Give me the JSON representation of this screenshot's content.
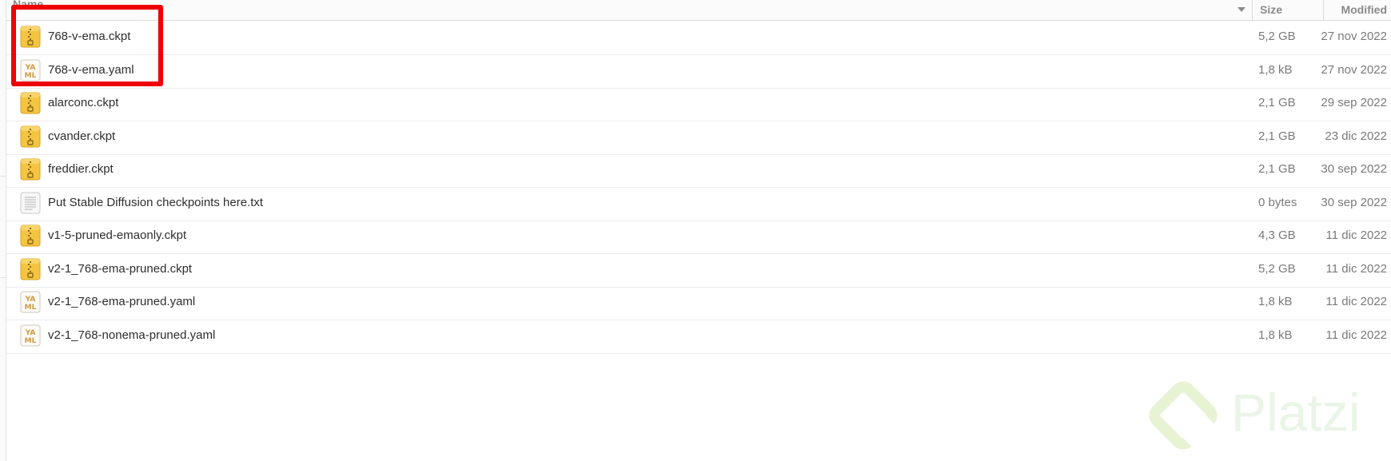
{
  "header": {
    "name_label": "Name",
    "size_label": "Size",
    "modified_label": "Modified"
  },
  "files": [
    {
      "name": "768-v-ema.ckpt",
      "size": "5,2 GB",
      "modified": "27 nov 2022",
      "icon": "archive-icon"
    },
    {
      "name": "768-v-ema.yaml",
      "size": "1,8 kB",
      "modified": "27 nov 2022",
      "icon": "yaml-icon"
    },
    {
      "name": "alarconc.ckpt",
      "size": "2,1 GB",
      "modified": "29 sep 2022",
      "icon": "archive-icon"
    },
    {
      "name": "cvander.ckpt",
      "size": "2,1 GB",
      "modified": "23 dic 2022",
      "icon": "archive-icon"
    },
    {
      "name": "freddier.ckpt",
      "size": "2,1 GB",
      "modified": "30 sep 2022",
      "icon": "archive-icon"
    },
    {
      "name": "Put Stable Diffusion checkpoints here.txt",
      "size": "0 bytes",
      "modified": "30 sep 2022",
      "icon": "text-file-icon"
    },
    {
      "name": "v1-5-pruned-emaonly.ckpt",
      "size": "4,3 GB",
      "modified": "11 dic 2022",
      "icon": "archive-icon"
    },
    {
      "name": "v2-1_768-ema-pruned.ckpt",
      "size": "5,2 GB",
      "modified": "11 dic 2022",
      "icon": "archive-icon"
    },
    {
      "name": "v2-1_768-ema-pruned.yaml",
      "size": "1,8 kB",
      "modified": "11 dic 2022",
      "icon": "yaml-icon"
    },
    {
      "name": "v2-1_768-nonema-pruned.yaml",
      "size": "1,8 kB",
      "modified": "11 dic 2022",
      "icon": "yaml-icon"
    }
  ],
  "highlight_color": "#ee0000",
  "watermark": {
    "text": "Platzi",
    "color": "#98ca3f"
  }
}
